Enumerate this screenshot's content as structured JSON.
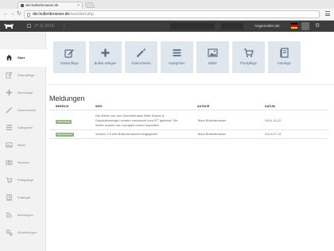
{
  "browser": {
    "tab_title": "der.bullenbrowser.de",
    "tab_close": "×",
    "url_host": "der.bullenbrowser.de",
    "url_path": "/neu/start.php",
    "back": "←",
    "forward": "→",
    "reload": "↻"
  },
  "header": {
    "date": "27.11.2014",
    "login_text": "Angemeldet als:",
    "flag_colors": [
      "#000000",
      "#dd0000",
      "#ffce00"
    ],
    "settings_icon": "⚙"
  },
  "sidebar": {
    "items": [
      {
        "label": "Start",
        "icon": "home-icon",
        "active": true
      },
      {
        "label": "Datenpflege",
        "icon": "edit-icon",
        "active": false
      },
      {
        "label": "Neuanlage",
        "icon": "plus-icon",
        "active": false
      },
      {
        "label": "Datenchecks",
        "icon": "wand-icon",
        "active": false
      },
      {
        "label": "Kategorien",
        "icon": "list-icon",
        "active": false
      },
      {
        "label": "Bilder",
        "icon": "image-icon",
        "active": false
      },
      {
        "label": "Rechten",
        "icon": "camera-icon",
        "active": false
      },
      {
        "label": "Preispflege",
        "icon": "cart-icon",
        "active": false
      },
      {
        "label": "Kataloge",
        "icon": "book-icon",
        "active": false
      },
      {
        "label": "Meldungen",
        "icon": "rss-icon",
        "active": false
      },
      {
        "label": "Einstellungen",
        "icon": "gears-icon",
        "active": false
      }
    ]
  },
  "tiles": [
    {
      "label": "Datenpflege",
      "icon": "edit-icon"
    },
    {
      "label": "Bullen anlegen",
      "icon": "plus-icon"
    },
    {
      "label": "Datenchecks",
      "icon": "wand-icon"
    },
    {
      "label": "Kategorien",
      "icon": "list-icon"
    },
    {
      "label": "Bilder",
      "icon": "image-icon"
    },
    {
      "label": "Preispflege",
      "icon": "cart-icon"
    },
    {
      "label": "Kataloge",
      "icon": "book-icon"
    }
  ],
  "messages": {
    "title": "Meldungen",
    "columns": [
      "BEREICH",
      "INFO",
      "AUTHOR",
      "DATUM"
    ],
    "rows": [
      {
        "area": "Datenpflege",
        "info_lines": [
          "Die Werte von den Geimerkmalen Beta Kasein &",
          "Doppellendergen wurden vertauscht vom IFT geliefert. Die",
          "Werte wurden nun korrigiert erneut importiert."
        ],
        "author": "Team Bullenbrowser",
        "date": "2014-10-22"
      },
      {
        "area": "Bullenbrowser",
        "info_lines": [
          "Version 2.0 des Bullenbrowsers freigegeben"
        ],
        "author": "Team Bullenbrowser",
        "date": "2014-07-15"
      }
    ]
  },
  "colors": {
    "accent_tile": "#dfe6ee",
    "tile_icon": "#5a6f86",
    "badge": "#8fb47d",
    "header_bg": "#3c3c3c"
  }
}
